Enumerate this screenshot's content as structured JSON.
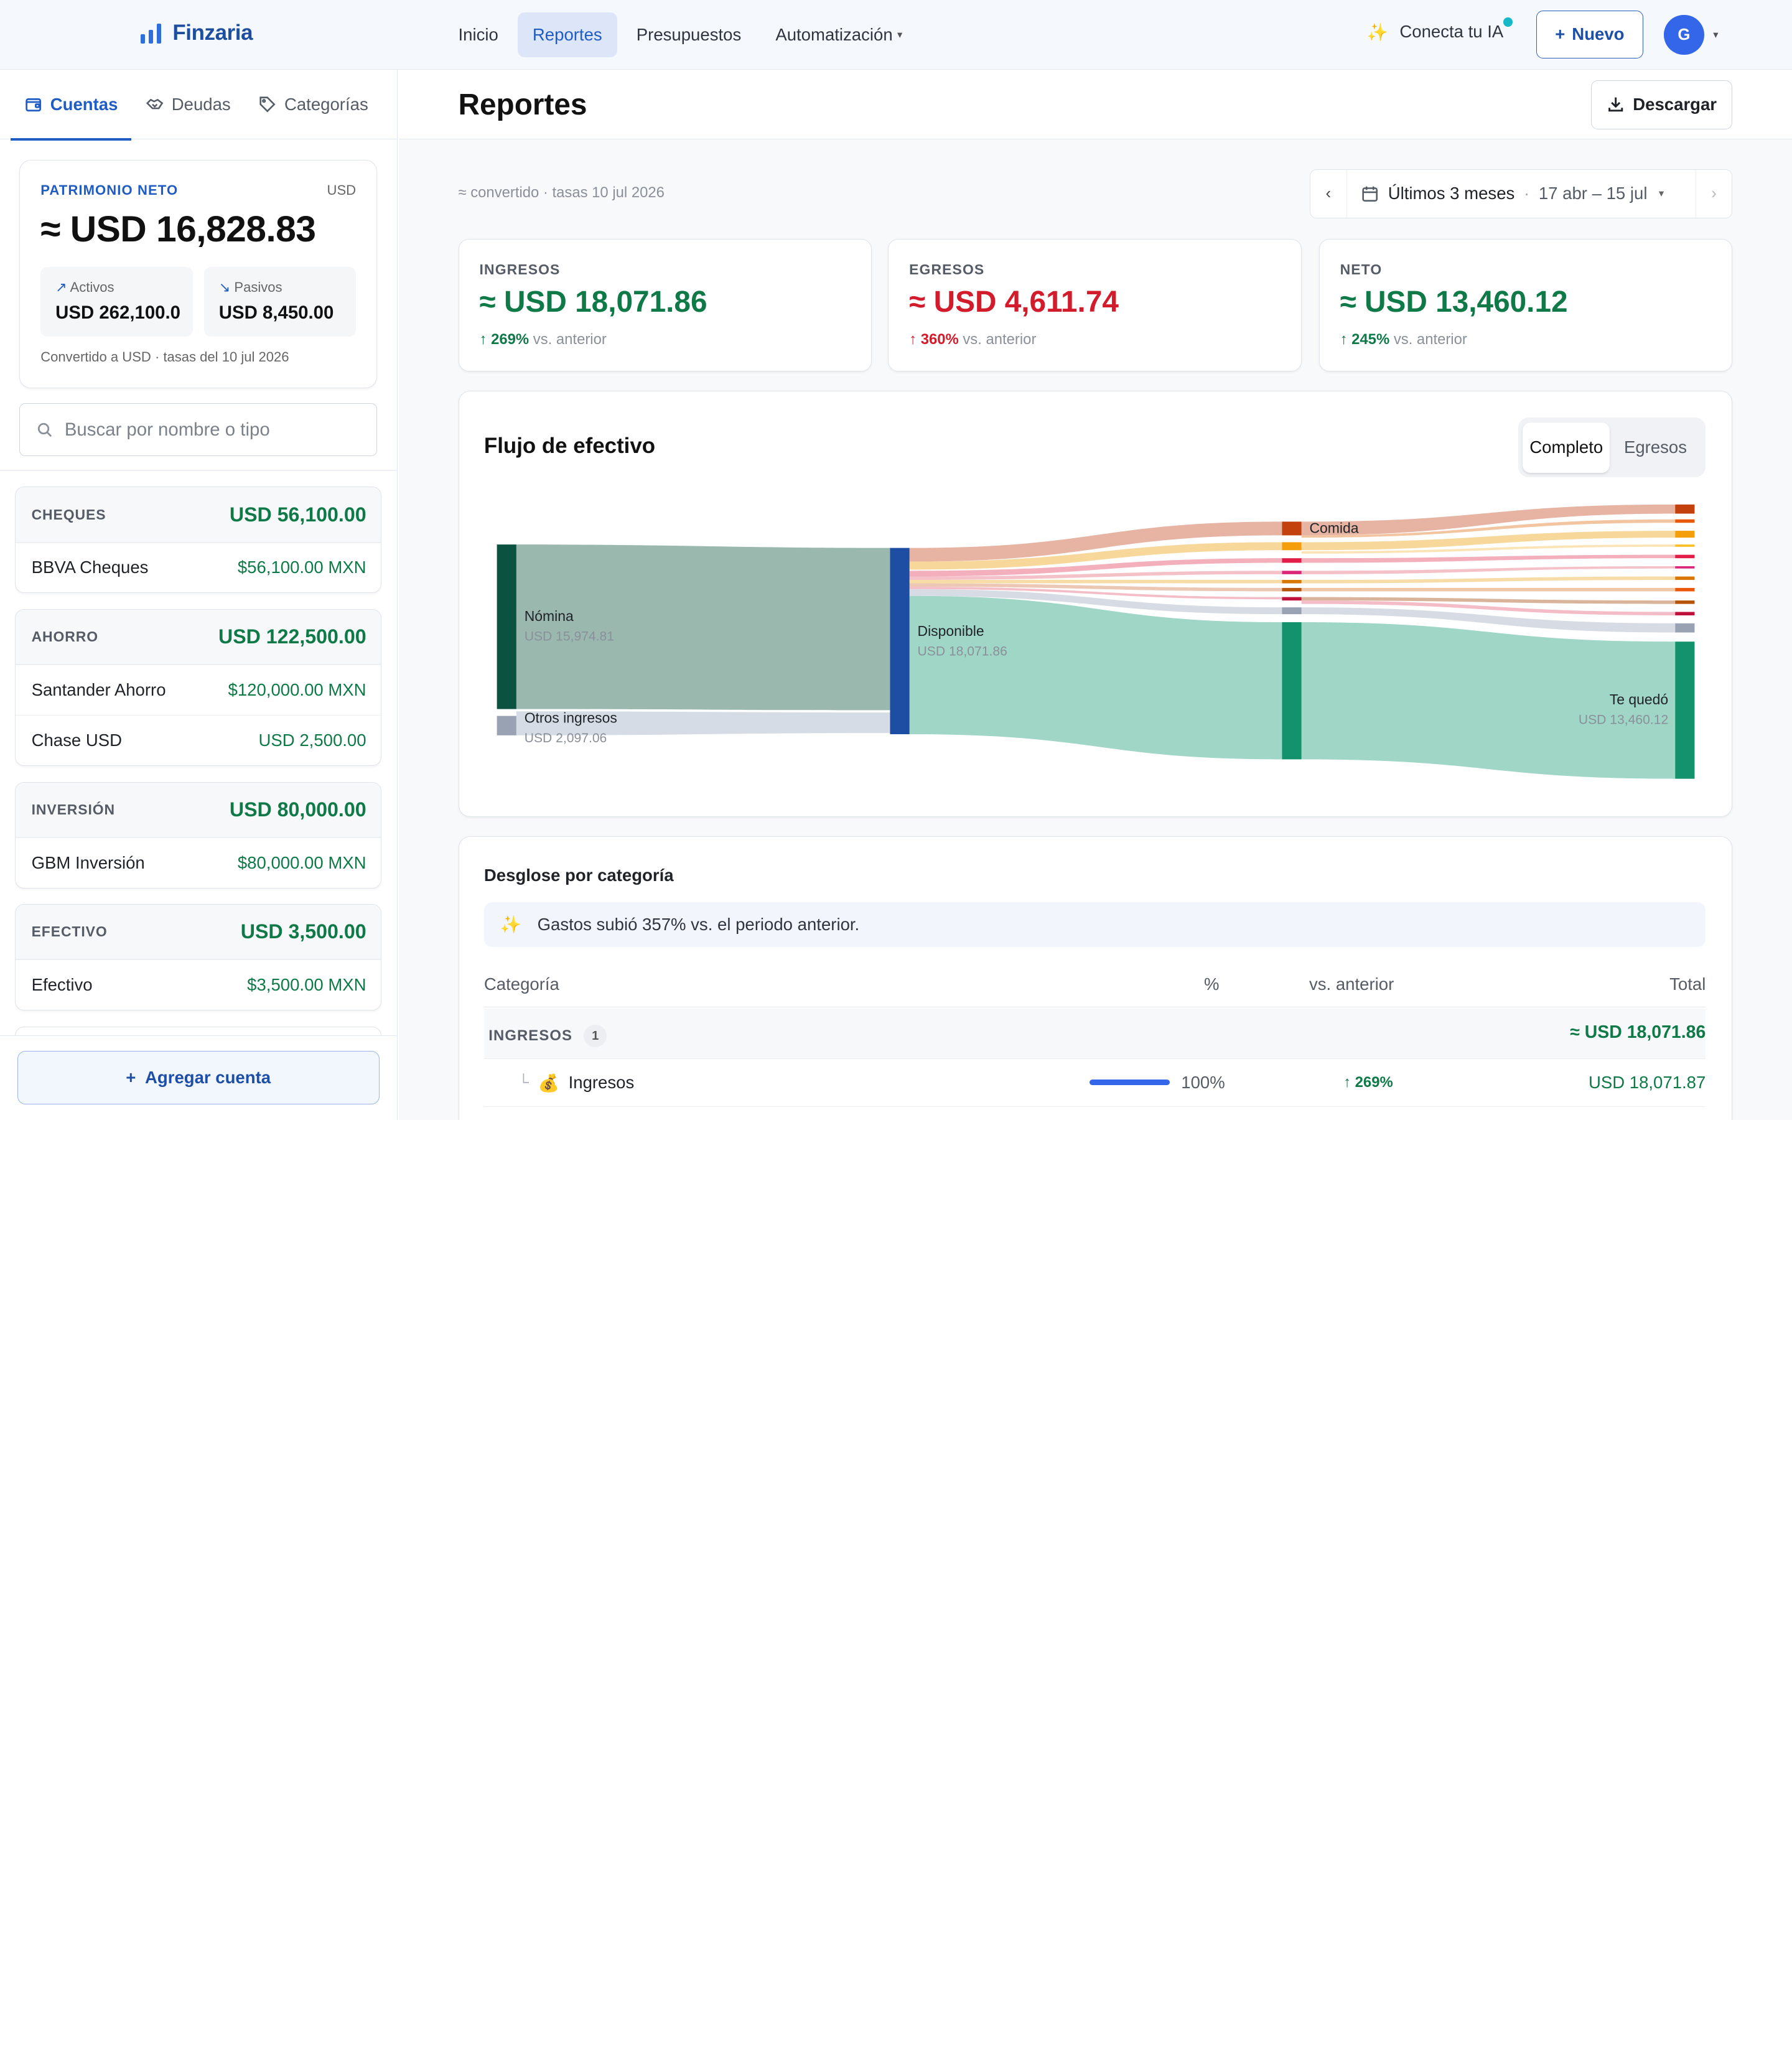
{
  "app": {
    "name": "Finzaria"
  },
  "nav": {
    "items": [
      {
        "label": "Inicio"
      },
      {
        "label": "Reportes"
      },
      {
        "label": "Presupuestos"
      },
      {
        "label": "Automatización"
      }
    ],
    "ia_label": "Conecta tu IA",
    "new_label": "Nuevo",
    "avatar_initial": "G"
  },
  "sidebar": {
    "tabs": [
      {
        "label": "Cuentas"
      },
      {
        "label": "Deudas"
      },
      {
        "label": "Categorías"
      }
    ],
    "networth": {
      "label": "PATRIMONIO NETO",
      "currency": "USD",
      "value": "≈ USD 16,828.83",
      "assets_label": "Activos",
      "assets_value": "USD 262,100.0",
      "liabilities_label": "Pasivos",
      "liabilities_value": "USD 8,450.00",
      "note": "Convertido a USD · tasas del 10 jul 2026"
    },
    "search_placeholder": "Buscar por nombre o tipo",
    "groups": [
      {
        "name": "CHEQUES",
        "total": "USD 56,100.00",
        "accounts": [
          {
            "name": "BBVA Cheques",
            "amount": "$56,100.00 MXN"
          }
        ]
      },
      {
        "name": "AHORRO",
        "total": "USD 122,500.00",
        "accounts": [
          {
            "name": "Santander Ahorro",
            "amount": "$120,000.00 MXN"
          },
          {
            "name": "Chase USD",
            "amount": "USD 2,500.00"
          }
        ]
      },
      {
        "name": "INVERSIÓN",
        "total": "USD 80,000.00",
        "accounts": [
          {
            "name": "GBM Inversión",
            "amount": "$80,000.00 MXN"
          }
        ]
      },
      {
        "name": "EFECTIVO",
        "total": "USD 3,500.00",
        "accounts": [
          {
            "name": "Efectivo",
            "amount": "$3,500.00 MXN"
          }
        ]
      }
    ],
    "add_label": "Agregar cuenta"
  },
  "main": {
    "title": "Reportes",
    "download_label": "Descargar",
    "conversion_note": "≈ convertido · tasas 10 jul 2026",
    "range": {
      "label": "Últimos 3 meses",
      "dates": "17 abr – 15 jul"
    },
    "kpis": [
      {
        "label": "INGRESOS",
        "value": "≈ USD 18,071.86",
        "delta": "↑ 269%",
        "delta_suffix": "vs. anterior",
        "color": "#0f7a48"
      },
      {
        "label": "EGRESOS",
        "value": "≈ USD 4,611.74",
        "delta": "↑ 360%",
        "delta_suffix": "vs. anterior",
        "color": "#d21c2b"
      },
      {
        "label": "NETO",
        "value": "≈ USD 13,460.12",
        "delta": "↑ 245%",
        "delta_suffix": "vs. anterior",
        "color": "#0f7a48"
      }
    ],
    "cashflow": {
      "title": "Flujo de efectivo",
      "toggle": [
        {
          "label": "Completo"
        },
        {
          "label": "Egresos"
        }
      ],
      "nodes": {
        "nomina": {
          "label": "Nómina",
          "value": "USD 15,974.81"
        },
        "otros": {
          "label": "Otros ingresos",
          "value": "USD 2,097.06"
        },
        "disponible": {
          "label": "Disponible",
          "value": "USD 18,071.86"
        },
        "comida": {
          "label": "Comida"
        },
        "te_quedo": {
          "label": "Te quedó",
          "value": "USD 13,460.12"
        }
      },
      "flows": {
        "nomina": 15974.81,
        "otros_ingresos": 2097.06,
        "disponible": 18071.86,
        "te_quedo": 13460.12
      }
    },
    "breakdown": {
      "title": "Desglose por categoría",
      "insight": "Gastos subió 357% vs. el periodo anterior.",
      "columns": {
        "category": "Categoría",
        "pct": "%",
        "vs": "vs. anterior",
        "total": "Total"
      },
      "section": {
        "name": "INGRESOS",
        "count": "1",
        "total": "≈ USD 18,071.86"
      },
      "row": {
        "emoji": "💰",
        "name": "Ingresos",
        "pct": "100%",
        "pct_value": 100,
        "vs": "↑ 269%",
        "total": "USD 18,071.87"
      }
    }
  },
  "colors": {
    "accent": "#1f5cc4",
    "positive": "#0f7a48",
    "negative": "#d21c2b",
    "income_node": "#0b5240",
    "available_node": "#1d4ea3",
    "saved_node": "#13926d"
  }
}
